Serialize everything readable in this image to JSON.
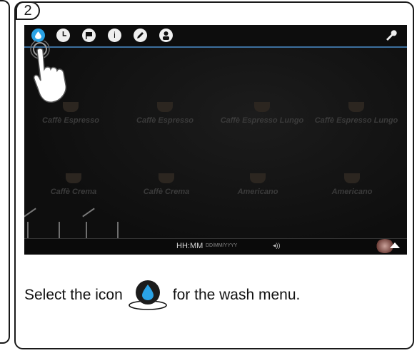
{
  "step": {
    "number": "2"
  },
  "screen": {
    "topbar": {
      "icons": [
        "water-drop-icon",
        "clock-icon",
        "flag-icon",
        "info-icon",
        "pencil-icon",
        "person-icon",
        "wrench-icon"
      ],
      "info_glyph": "i"
    },
    "products": [
      {
        "label": "Caffè Espresso"
      },
      {
        "label": "Caffè Espresso"
      },
      {
        "label": "Caffè Espresso Lungo"
      },
      {
        "label": "Caffè Espresso Lungo"
      },
      {
        "label": "Caffè Crema"
      },
      {
        "label": "Caffè Crema"
      },
      {
        "label": "Americano"
      },
      {
        "label": "Americano"
      }
    ],
    "bottombar": {
      "time": "HH:MM",
      "date": "DD/MM/YYYY"
    },
    "accent_color": "#2aa3e6"
  },
  "instruction": {
    "before": "Select the icon",
    "after": "for the wash menu."
  }
}
